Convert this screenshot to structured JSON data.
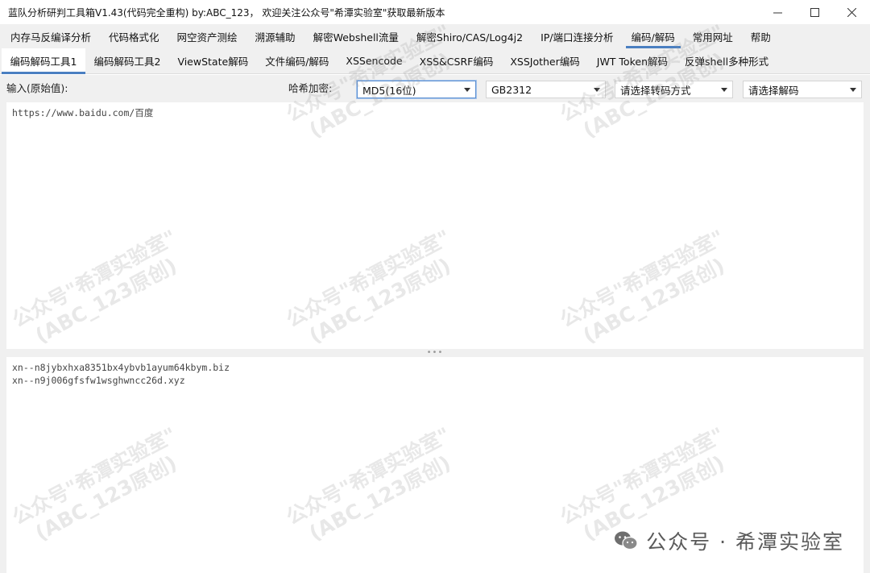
{
  "window": {
    "title": "蓝队分析研判工具箱V1.43(代码完全重构) by:ABC_123， 欢迎关注公众号\"希潭实验室\"获取最新版本",
    "controls": [
      "minimize",
      "maximize",
      "close"
    ]
  },
  "menu": [
    {
      "label": "内存马反编译分析",
      "active": false
    },
    {
      "label": "代码格式化",
      "active": false
    },
    {
      "label": "网空资产测绘",
      "active": false
    },
    {
      "label": "溯源辅助",
      "active": false
    },
    {
      "label": "解密Webshell流量",
      "active": false
    },
    {
      "label": "解密Shiro/CAS/Log4j2",
      "active": false
    },
    {
      "label": "IP/端口连接分析",
      "active": false
    },
    {
      "label": "编码/解码",
      "active": true
    },
    {
      "label": "常用网址",
      "active": false
    },
    {
      "label": "帮助",
      "active": false
    }
  ],
  "tabs": [
    {
      "label": "编码解码工具1",
      "active": true
    },
    {
      "label": "编码解码工具2",
      "active": false
    },
    {
      "label": "ViewState解码",
      "active": false
    },
    {
      "label": "文件编码/解码",
      "active": false
    },
    {
      "label": "XSSencode",
      "active": false
    },
    {
      "label": "XSS&CSRF编码",
      "active": false
    },
    {
      "label": "XSSJother编码",
      "active": false
    },
    {
      "label": "JWT Token解码",
      "active": false
    },
    {
      "label": "反弹shell多种形式",
      "active": false
    }
  ],
  "options": {
    "input_label": "输入(原始值):",
    "hash_label": "哈希加密:",
    "hash_select": "MD5(16位)",
    "charset_select": "GB2312",
    "transcode_select": "请选择转码方式",
    "decode_select": "请选择解码"
  },
  "input_text": "https://www.baidu.com/百度",
  "output_lines": [
    "xn--n8jybxhxa8351bx4ybvb1ayum64kbym.biz",
    "xn--n9j006gfsfw1wsghwncc26d.xyz"
  ],
  "watermark": {
    "line1": "公众号\"希潭实验室\"",
    "line2": "(ABC_123原创)"
  },
  "brand": {
    "text": "公众号 · 希潭实验室",
    "icon": "wechat-icon"
  },
  "colors": {
    "accent": "#4a7fc1",
    "chrome": "#f0f0f0"
  }
}
